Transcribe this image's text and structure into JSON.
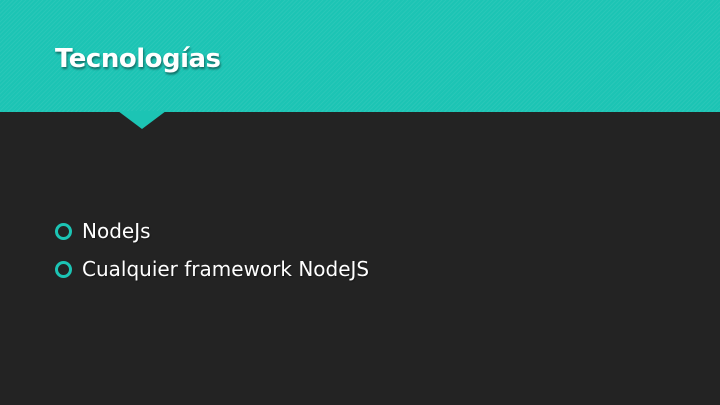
{
  "slide": {
    "title": "Tecnologías",
    "bullets": [
      {
        "text": "NodeJs",
        "icon": "ring-bullet-icon"
      },
      {
        "text": "Cualquier framework NodeJS",
        "icon": "ring-bullet-icon"
      }
    ]
  },
  "colors": {
    "accent": "#1cc4b4",
    "background": "#232323",
    "text": "#ffffff"
  }
}
